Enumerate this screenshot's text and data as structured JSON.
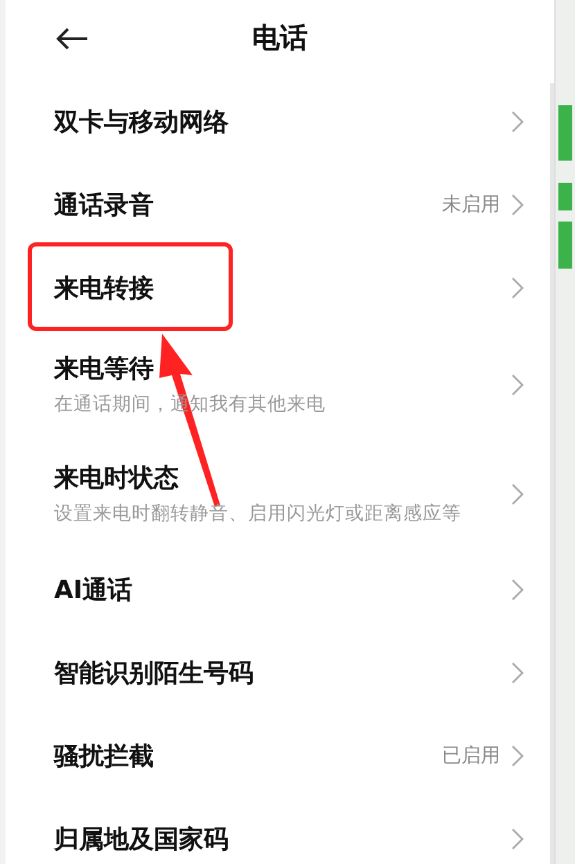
{
  "header": {
    "title": "电话"
  },
  "items": [
    {
      "title": "双卡与移动网络",
      "highlighted": false
    },
    {
      "title": "通话录音",
      "value": "未启用",
      "highlighted": false
    },
    {
      "title": "来电转接",
      "highlighted": true
    },
    {
      "title": "来电等待",
      "subtitle": "在通话期间，通知我有其他来电",
      "highlighted": false
    },
    {
      "title": "来电时状态",
      "subtitle": "设置来电时翻转静音、启用闪光灯或距离感应等",
      "highlighted": false
    },
    {
      "title": "AI通话",
      "highlighted": false
    },
    {
      "title": "智能识别陌生号码",
      "highlighted": false
    },
    {
      "title": "骚扰拦截",
      "value": "已启用",
      "highlighted": false
    },
    {
      "title": "归属地及国家码",
      "highlighted": false
    }
  ]
}
